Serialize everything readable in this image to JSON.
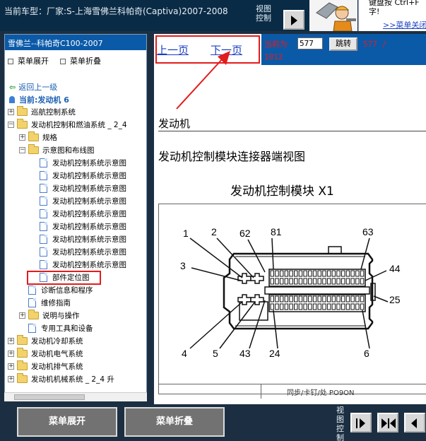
{
  "topbar": {
    "car_model": "当前车型：厂家:S-上海雪佛兰科帕奇(Captiva)2007-2008",
    "view_control_label": "视图控制",
    "help_text": "键盘按 Ctrl+F 字!",
    "help_link": ">>菜单关闭"
  },
  "sidebar": {
    "title": "雪佛兰--科帕奇C100-2007",
    "expand_menu": "菜单展开",
    "collapse_menu": "菜单折叠",
    "back": "返回上一级",
    "current": "当前:发动机 6",
    "items": [
      {
        "label": "巡航控制系统",
        "kind": "folder",
        "expander": "+"
      },
      {
        "label": "发动机控制和燃油系统 _ 2_4",
        "kind": "folder",
        "expander": "−"
      },
      {
        "label": "规格",
        "kind": "folder",
        "expander": "+"
      },
      {
        "label": "示意图和布线图",
        "kind": "folder",
        "expander": "−"
      },
      {
        "label": "发动机控制系统示意图",
        "kind": "doc"
      },
      {
        "label": "发动机控制系统示意图",
        "kind": "doc"
      },
      {
        "label": "发动机控制系统示意图",
        "kind": "doc"
      },
      {
        "label": "发动机控制系统示意图",
        "kind": "doc"
      },
      {
        "label": "发动机控制系统示意图",
        "kind": "doc"
      },
      {
        "label": "发动机控制系统示意图",
        "kind": "doc"
      },
      {
        "label": "发动机控制系统示意图",
        "kind": "doc"
      },
      {
        "label": "发动机控制系统示意图",
        "kind": "doc"
      },
      {
        "label": "发动机控制系统示意图",
        "kind": "doc"
      },
      {
        "label": "部件定位图",
        "kind": "doc"
      },
      {
        "label": "诊断信息和程序",
        "kind": "doc"
      },
      {
        "label": "维修指南",
        "kind": "doc"
      },
      {
        "label": "说明与操作",
        "kind": "folder",
        "expander": "+"
      },
      {
        "label": "专用工具和设备",
        "kind": "doc"
      },
      {
        "label": "发动机冷却系统",
        "kind": "folder",
        "expander": "+"
      },
      {
        "label": "发动机电气系统",
        "kind": "folder",
        "expander": "+"
      },
      {
        "label": "发动机排气系统",
        "kind": "folder",
        "expander": "+"
      },
      {
        "label": "发动机机械系统 _ 2_4 升",
        "kind": "folder",
        "expander": "+"
      }
    ]
  },
  "nav": {
    "prev_label": "上一页",
    "next_label": "下一页",
    "current_prefix": "当前为",
    "current_page": "577",
    "jump_label": "跳转",
    "total_a": "577 /",
    "total_b": "1012"
  },
  "document": {
    "title": "发动机",
    "subtitle": "发动机控制模块连接器端视图",
    "figure_title": "发动机控制模块 X1",
    "footer_text": "同步/卡钉/处 PO9ON",
    "pin_labels": {
      "p1": "1",
      "p2": "2",
      "p62": "62",
      "p81": "81",
      "p63": "63",
      "p3": "3",
      "p44": "44",
      "p25": "25",
      "p4": "4",
      "p5": "5",
      "p43": "43",
      "p24": "24",
      "p6": "6"
    }
  },
  "bottombar": {
    "expand_menu": "菜单展开",
    "collapse_menu": "菜单折叠",
    "view_control_label": "视图控制"
  },
  "colors": {
    "highlight": "#e31c1c",
    "link": "#1a3fc4",
    "sidebar_header": "#0b5aa8"
  }
}
